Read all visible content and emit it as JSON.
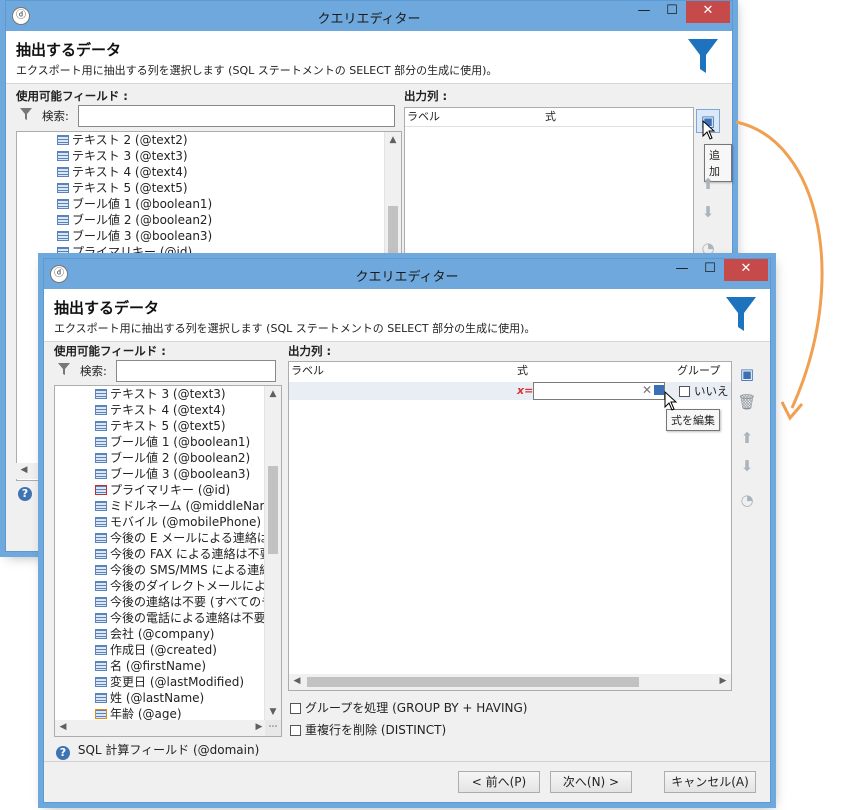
{
  "back_window": {
    "title": "クエリエディター",
    "header_title": "抽出するデータ",
    "header_subtitle": "エクスポート用に抽出する列を選択します (SQL ステートメントの SELECT 部分の生成に使用)。",
    "available_fields_label": "使用可能フィールド :",
    "search_label": "検索:",
    "search_value": "",
    "fields": [
      "テキスト 2 (@text2)",
      "テキスト 3 (@text3)",
      "テキスト 4 (@text4)",
      "テキスト 5 (@text5)",
      "ブール値 1 (@boolean1)",
      "ブール値 2 (@boolean2)",
      "ブール値 3 (@boolean3)",
      "プライマリキー (@id)"
    ],
    "output_label": "出力列 :",
    "col_label": "ラベル",
    "col_expression": "式",
    "tooltip_add": "追加"
  },
  "front_window": {
    "title": "クエリエディター",
    "header_title": "抽出するデータ",
    "header_subtitle": "エクスポート用に抽出する列を選択します (SQL ステートメントの SELECT 部分の生成に使用)。",
    "available_fields_label": "使用可能フィールド :",
    "search_label": "検索:",
    "search_value": "",
    "fields": [
      "テキスト 3 (@text3)",
      "テキスト 4 (@text4)",
      "テキスト 5 (@text5)",
      "ブール値 1 (@boolean1)",
      "ブール値 2 (@boolean2)",
      "ブール値 3 (@boolean3)",
      "プライマリキー (@id)",
      "ミドルネーム (@middleName)",
      "モバイル (@mobilePhone)",
      "今後の E メールによる連絡は不要",
      "今後の FAX による連絡は不要",
      "今後の SMS/MMS による連絡",
      "今後のダイレクトメールによる連絡",
      "今後の連絡は不要 (すべてのチャ",
      "今後の電話による連絡は不要 (",
      "会社 (@company)",
      "作成日 (@created)",
      "名 (@firstName)",
      "変更日 (@lastModified)",
      "姓 (@lastName)",
      "年齢 (@age)"
    ],
    "output_label": "出力列 :",
    "col_label": "ラベル",
    "col_expression": "式",
    "col_group": "グループ",
    "row_expr_marker": "x=",
    "row_group_value": "いいえ",
    "tooltip_edit": "式を編集",
    "group_by_label": "グループを処理 (GROUP BY + HAVING)",
    "distinct_label": "重複行を削除 (DISTINCT)",
    "sql_field_label": "SQL 計算フィールド (@domain)",
    "btn_prev": "< 前へ(P)",
    "btn_next": "次へ(N) >",
    "btn_cancel": "キャンセル(A)"
  },
  "colors": {
    "titlebar": "#6fa8dc",
    "close": "#c74a4a",
    "accent_arrow": "#f0a050",
    "funnel": "#1e73be"
  }
}
